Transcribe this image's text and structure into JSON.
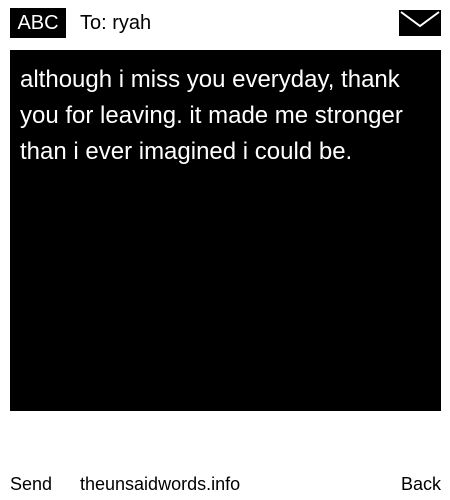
{
  "header": {
    "mode_label": "ABC",
    "to_text": "To: ryah",
    "envelope_icon": "envelope-icon"
  },
  "message": {
    "body": "although i miss you everyday, thank you for leaving. it made me stronger than i ever imagined i could be."
  },
  "footer": {
    "left_softkey": "Send",
    "site": "theunsaidwords.info",
    "right_softkey": "Back"
  },
  "colors": {
    "background": "#ffffff",
    "message_background": "#000000",
    "message_text": "#ffffff"
  }
}
